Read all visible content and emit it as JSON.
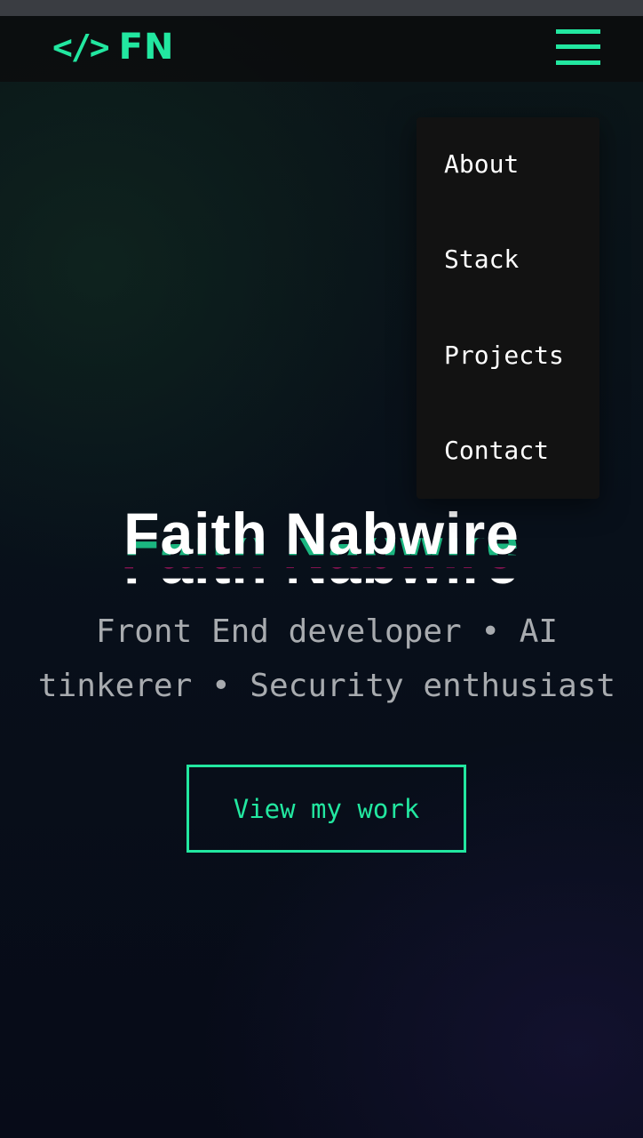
{
  "header": {
    "logo_glyph": "</>",
    "logo_text": "FN",
    "menu_icon": "hamburger-menu-icon"
  },
  "nav_menu": {
    "items": [
      {
        "label": "About"
      },
      {
        "label": "Stack"
      },
      {
        "label": "Projects"
      },
      {
        "label": "Contact"
      }
    ]
  },
  "hero": {
    "name": "Faith Nabwire",
    "tagline": "Front End developer • AI tinkerer • Security enthusiast",
    "cta_label": "View my work"
  },
  "colors": {
    "accent": "#22e7a0",
    "background": "#08101a",
    "menu_background": "#121212",
    "glitch_pink": "#e0157a"
  }
}
